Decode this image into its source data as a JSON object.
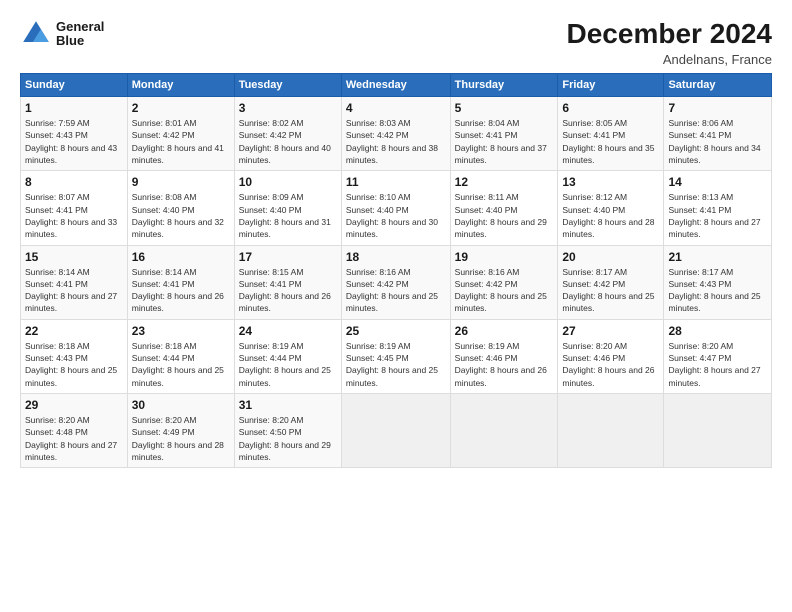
{
  "logo": {
    "line1": "General",
    "line2": "Blue"
  },
  "title": "December 2024",
  "location": "Andelnans, France",
  "headers": [
    "Sunday",
    "Monday",
    "Tuesday",
    "Wednesday",
    "Thursday",
    "Friday",
    "Saturday"
  ],
  "weeks": [
    [
      {
        "day": "1",
        "sunrise": "7:59 AM",
        "sunset": "4:43 PM",
        "daylight": "8 hours and 43 minutes."
      },
      {
        "day": "2",
        "sunrise": "8:01 AM",
        "sunset": "4:42 PM",
        "daylight": "8 hours and 41 minutes."
      },
      {
        "day": "3",
        "sunrise": "8:02 AM",
        "sunset": "4:42 PM",
        "daylight": "8 hours and 40 minutes."
      },
      {
        "day": "4",
        "sunrise": "8:03 AM",
        "sunset": "4:42 PM",
        "daylight": "8 hours and 38 minutes."
      },
      {
        "day": "5",
        "sunrise": "8:04 AM",
        "sunset": "4:41 PM",
        "daylight": "8 hours and 37 minutes."
      },
      {
        "day": "6",
        "sunrise": "8:05 AM",
        "sunset": "4:41 PM",
        "daylight": "8 hours and 35 minutes."
      },
      {
        "day": "7",
        "sunrise": "8:06 AM",
        "sunset": "4:41 PM",
        "daylight": "8 hours and 34 minutes."
      }
    ],
    [
      {
        "day": "8",
        "sunrise": "8:07 AM",
        "sunset": "4:41 PM",
        "daylight": "8 hours and 33 minutes."
      },
      {
        "day": "9",
        "sunrise": "8:08 AM",
        "sunset": "4:40 PM",
        "daylight": "8 hours and 32 minutes."
      },
      {
        "day": "10",
        "sunrise": "8:09 AM",
        "sunset": "4:40 PM",
        "daylight": "8 hours and 31 minutes."
      },
      {
        "day": "11",
        "sunrise": "8:10 AM",
        "sunset": "4:40 PM",
        "daylight": "8 hours and 30 minutes."
      },
      {
        "day": "12",
        "sunrise": "8:11 AM",
        "sunset": "4:40 PM",
        "daylight": "8 hours and 29 minutes."
      },
      {
        "day": "13",
        "sunrise": "8:12 AM",
        "sunset": "4:40 PM",
        "daylight": "8 hours and 28 minutes."
      },
      {
        "day": "14",
        "sunrise": "8:13 AM",
        "sunset": "4:41 PM",
        "daylight": "8 hours and 27 minutes."
      }
    ],
    [
      {
        "day": "15",
        "sunrise": "8:14 AM",
        "sunset": "4:41 PM",
        "daylight": "8 hours and 27 minutes."
      },
      {
        "day": "16",
        "sunrise": "8:14 AM",
        "sunset": "4:41 PM",
        "daylight": "8 hours and 26 minutes."
      },
      {
        "day": "17",
        "sunrise": "8:15 AM",
        "sunset": "4:41 PM",
        "daylight": "8 hours and 26 minutes."
      },
      {
        "day": "18",
        "sunrise": "8:16 AM",
        "sunset": "4:42 PM",
        "daylight": "8 hours and 25 minutes."
      },
      {
        "day": "19",
        "sunrise": "8:16 AM",
        "sunset": "4:42 PM",
        "daylight": "8 hours and 25 minutes."
      },
      {
        "day": "20",
        "sunrise": "8:17 AM",
        "sunset": "4:42 PM",
        "daylight": "8 hours and 25 minutes."
      },
      {
        "day": "21",
        "sunrise": "8:17 AM",
        "sunset": "4:43 PM",
        "daylight": "8 hours and 25 minutes."
      }
    ],
    [
      {
        "day": "22",
        "sunrise": "8:18 AM",
        "sunset": "4:43 PM",
        "daylight": "8 hours and 25 minutes."
      },
      {
        "day": "23",
        "sunrise": "8:18 AM",
        "sunset": "4:44 PM",
        "daylight": "8 hours and 25 minutes."
      },
      {
        "day": "24",
        "sunrise": "8:19 AM",
        "sunset": "4:44 PM",
        "daylight": "8 hours and 25 minutes."
      },
      {
        "day": "25",
        "sunrise": "8:19 AM",
        "sunset": "4:45 PM",
        "daylight": "8 hours and 25 minutes."
      },
      {
        "day": "26",
        "sunrise": "8:19 AM",
        "sunset": "4:46 PM",
        "daylight": "8 hours and 26 minutes."
      },
      {
        "day": "27",
        "sunrise": "8:20 AM",
        "sunset": "4:46 PM",
        "daylight": "8 hours and 26 minutes."
      },
      {
        "day": "28",
        "sunrise": "8:20 AM",
        "sunset": "4:47 PM",
        "daylight": "8 hours and 27 minutes."
      }
    ],
    [
      {
        "day": "29",
        "sunrise": "8:20 AM",
        "sunset": "4:48 PM",
        "daylight": "8 hours and 27 minutes."
      },
      {
        "day": "30",
        "sunrise": "8:20 AM",
        "sunset": "4:49 PM",
        "daylight": "8 hours and 28 minutes."
      },
      {
        "day": "31",
        "sunrise": "8:20 AM",
        "sunset": "4:50 PM",
        "daylight": "8 hours and 29 minutes."
      },
      null,
      null,
      null,
      null
    ]
  ],
  "labels": {
    "sunrise": "Sunrise:",
    "sunset": "Sunset:",
    "daylight": "Daylight:"
  }
}
